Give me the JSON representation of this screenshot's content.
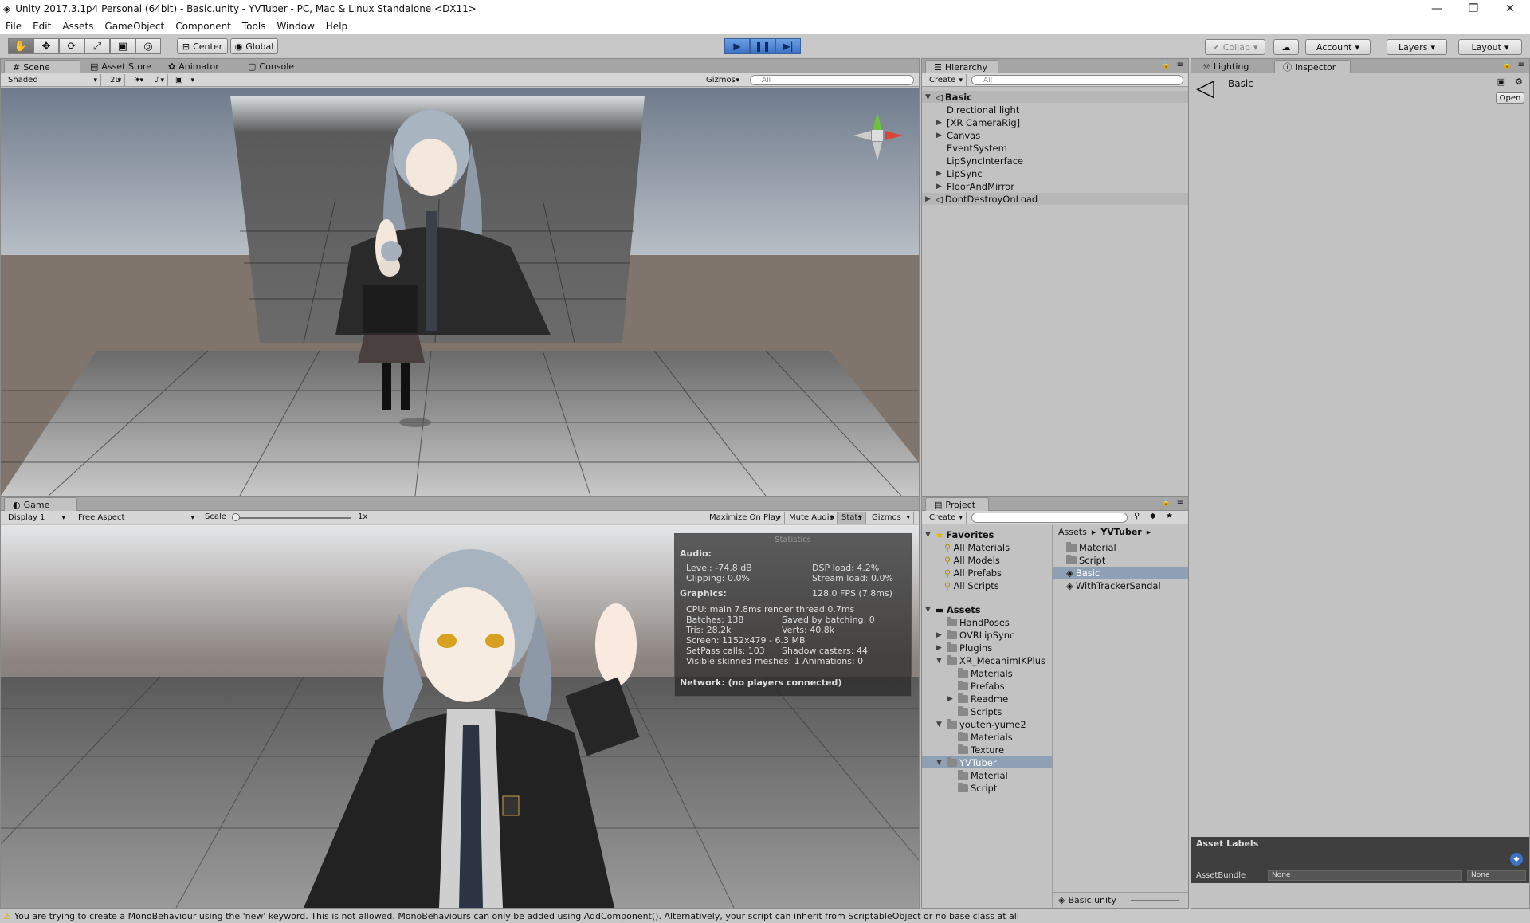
{
  "window": {
    "title": "Unity 2017.3.1p4 Personal (64bit) - Basic.unity - YVTuber - PC, Mac & Linux Standalone <DX11>",
    "minimize": "—",
    "restore": "❐",
    "close": "✕"
  },
  "menu": [
    "File",
    "Edit",
    "Assets",
    "GameObject",
    "Component",
    "Tools",
    "Window",
    "Help"
  ],
  "toolbar": {
    "pivot": "Center",
    "space": "Global",
    "collab": "Collab",
    "account": "Account",
    "layers": "Layers",
    "layout": "Layout"
  },
  "scene": {
    "tabs": [
      "Scene",
      "Asset Store",
      "Animator",
      "Console"
    ],
    "shading": "Shaded",
    "mode2d": "2D",
    "gizmos": "Gizmos",
    "search_placeholder": "All"
  },
  "game": {
    "tab": "Game",
    "display": "Display 1",
    "aspect": "Free Aspect",
    "scale_label": "Scale",
    "scale_value": "1x",
    "maximize": "Maximize On Play",
    "mute": "Mute Audio",
    "stats": "Stats",
    "gizmos": "Gizmos"
  },
  "statistics": {
    "title": "Statistics",
    "audio_heading": "Audio:",
    "level": "Level: -74.8 dB",
    "clipping": "Clipping: 0.0%",
    "dsp": "DSP load: 4.2%",
    "stream": "Stream load: 0.0%",
    "graphics_heading": "Graphics:",
    "fps": "128.0 FPS (7.8ms)",
    "cpu": "CPU: main 7.8ms  render thread 0.7ms",
    "batches": "Batches: 138",
    "saved": "Saved by batching: 0",
    "tris": "Tris: 28.2k",
    "verts": "Verts: 40.8k",
    "screen": "Screen: 1152x479 - 6.3 MB",
    "setpass": "SetPass calls: 103",
    "shadow": "Shadow casters: 44",
    "skinned": "Visible skinned meshes: 1  Animations: 0",
    "network": "Network: (no players connected)"
  },
  "hierarchy": {
    "tab": "Hierarchy",
    "create": "Create",
    "search_placeholder": "All",
    "items": [
      {
        "label": "Basic",
        "indent": 0,
        "arrow": "▼",
        "scene": true
      },
      {
        "label": "Directional light",
        "indent": 1,
        "arrow": ""
      },
      {
        "label": "[XR CameraRig]",
        "indent": 1,
        "arrow": "▶"
      },
      {
        "label": "Canvas",
        "indent": 1,
        "arrow": "▶"
      },
      {
        "label": "EventSystem",
        "indent": 1,
        "arrow": ""
      },
      {
        "label": "LipSyncInterface",
        "indent": 1,
        "arrow": ""
      },
      {
        "label": "LipSync",
        "indent": 1,
        "arrow": "▶"
      },
      {
        "label": "FloorAndMirror",
        "indent": 1,
        "arrow": "▶"
      },
      {
        "label": "DontDestroyOnLoad",
        "indent": 0,
        "arrow": "▶",
        "scene": true
      }
    ]
  },
  "project": {
    "tab": "Project",
    "create": "Create",
    "favorites_heading": "Favorites",
    "favorites": [
      "All Materials",
      "All Models",
      "All Prefabs",
      "All Scripts"
    ],
    "assets_heading": "Assets",
    "tree": [
      {
        "label": "HandPoses",
        "indent": 1,
        "arrow": ""
      },
      {
        "label": "OVRLipSync",
        "indent": 1,
        "arrow": "▶"
      },
      {
        "label": "Plugins",
        "indent": 1,
        "arrow": "▶"
      },
      {
        "label": "XR_MecanimIKPlus",
        "indent": 1,
        "arrow": "▼"
      },
      {
        "label": "Materials",
        "indent": 2,
        "arrow": ""
      },
      {
        "label": "Prefabs",
        "indent": 2,
        "arrow": ""
      },
      {
        "label": "Readme",
        "indent": 2,
        "arrow": "▶"
      },
      {
        "label": "Scripts",
        "indent": 2,
        "arrow": ""
      },
      {
        "label": "youten-yume2",
        "indent": 1,
        "arrow": "▼"
      },
      {
        "label": "Materials",
        "indent": 2,
        "arrow": ""
      },
      {
        "label": "Texture",
        "indent": 2,
        "arrow": ""
      },
      {
        "label": "YVTuber",
        "indent": 1,
        "arrow": "▼",
        "selected": true
      },
      {
        "label": "Material",
        "indent": 2,
        "arrow": ""
      },
      {
        "label": "Script",
        "indent": 2,
        "arrow": ""
      }
    ],
    "breadcrumb_root": "Assets",
    "breadcrumb_current": "YVTuber",
    "files": [
      {
        "label": "Material",
        "kind": "folder"
      },
      {
        "label": "Script",
        "kind": "folder"
      },
      {
        "label": "Basic",
        "kind": "scene",
        "selected": true
      },
      {
        "label": "WithTrackerSandal",
        "kind": "scene"
      }
    ],
    "footer_file": "Basic.unity"
  },
  "inspector": {
    "tabs": [
      "Lighting",
      "Inspector"
    ],
    "object_name": "Basic",
    "open_button": "Open",
    "asset_labels": "Asset Labels",
    "asset_bundle_label": "AssetBundle",
    "bundle_value": "None",
    "variant_value": "None"
  },
  "status": {
    "message": "You are trying to create a MonoBehaviour using the 'new' keyword.  This is not allowed.  MonoBehaviours can only be added using AddComponent().  Alternatively, your script can inherit from ScriptableObject or no base class at all"
  },
  "colors": {
    "play_accent": "#3c72c4",
    "selection": "#8fa0b5",
    "panel_bg": "#c2c2c2"
  }
}
